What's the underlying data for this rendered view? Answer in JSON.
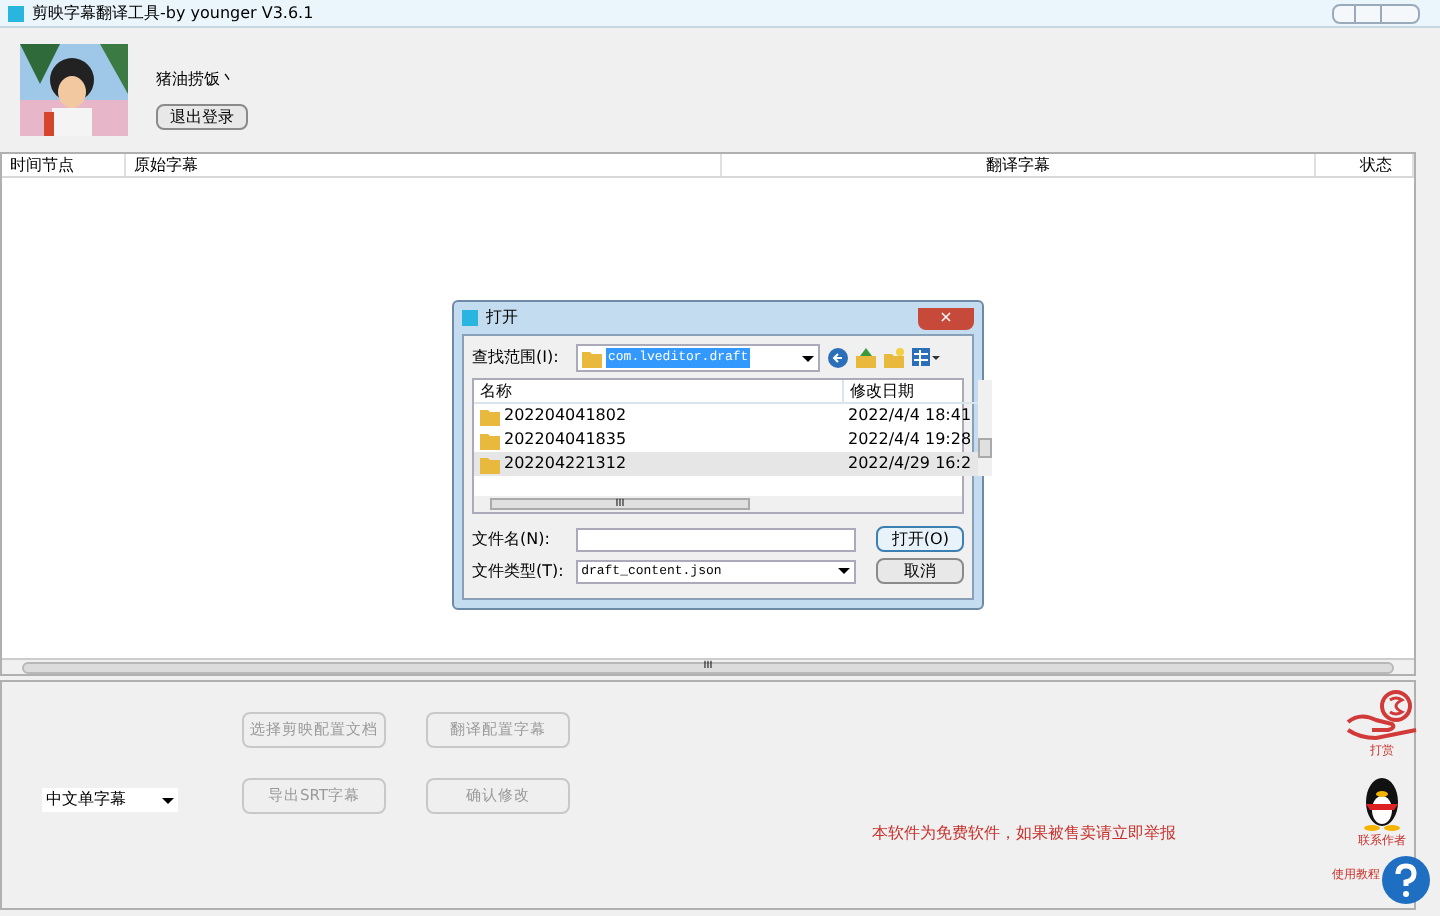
{
  "window": {
    "title": "剪映字幕翻译工具-by younger  V3.6.1"
  },
  "user": {
    "name": "猪油捞饭丶",
    "logout_button": "退出登录"
  },
  "table": {
    "columns": [
      "时间节点",
      "原始字幕",
      "翻译字幕",
      "状态"
    ]
  },
  "dialog": {
    "title": "打开",
    "close": "×",
    "look_in_label": "查找范围(I):",
    "look_in_value": "com.lveditor.draft",
    "columns": [
      "名称",
      "修改日期"
    ],
    "rows": [
      {
        "name": "202204041802",
        "date": "2022/4/4 18:41",
        "selected": false
      },
      {
        "name": "202204041835",
        "date": "2022/4/4 19:28",
        "selected": false
      },
      {
        "name": "202204221312",
        "date": "2022/4/29 16:2",
        "selected": true
      }
    ],
    "scroll_mark": "III",
    "filename_label": "文件名(N):",
    "filetype_label": "文件类型(T):",
    "filetype_value": "draft_content.json",
    "open_button": "打开(O)",
    "cancel_button": "取消"
  },
  "hscroll_mark": "III",
  "language_select": "中文单字幕",
  "buttons": [
    {
      "label": "选择剪映配置文档",
      "disabled": true
    },
    {
      "label": "翻译配置字幕",
      "disabled": true
    },
    {
      "label": "导出SRT字幕",
      "disabled": true
    },
    {
      "label": "确认修改",
      "disabled": true
    }
  ],
  "notice": "本软件为免费软件，如果被售卖请立即举报",
  "side_links": [
    {
      "kind": "donate",
      "label": "打赏"
    },
    {
      "kind": "qq",
      "label": "联系作者"
    },
    {
      "kind": "help",
      "label": "使用教程"
    }
  ]
}
